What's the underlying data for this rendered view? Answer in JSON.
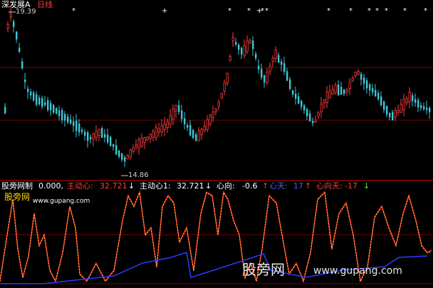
{
  "top_panel": {
    "stock_name": "深发展A",
    "period_label": "日线",
    "high_price_label": "19.39",
    "low_price_label": "14.86",
    "colors": {
      "up": "#ff3b3b",
      "down": "#3cc8d8",
      "name": "#ffffff",
      "period": "#ff3b3b",
      "grid": "#7a0000"
    }
  },
  "signal_stars": {
    "glyphs": [
      "*",
      "+",
      "*",
      "*",
      "+",
      "*",
      "*",
      "*",
      "*",
      "*",
      "*",
      "*",
      "*",
      "*"
    ]
  },
  "indicator_panel": {
    "title": "股旁网制",
    "base_value": "0.000,",
    "fields": [
      {
        "label": "主动心:",
        "value": "32.721",
        "arrow": "↓",
        "color": "#ff3b3b",
        "arrow_color": "#ffffff"
      },
      {
        "label": "主动心1:",
        "value": "32.721",
        "arrow": "↓",
        "color": "#ffffff",
        "arrow_color": "#ffffff"
      },
      {
        "label": "心向:",
        "value": "-0.6",
        "arrow": "↑",
        "color": "#ffffff",
        "arrow_color": "#ff3b3b"
      },
      {
        "label": "心天:",
        "value": "17",
        "arrow": "↑",
        "color": "#4a5cff",
        "arrow_color": "#ff3b3b"
      },
      {
        "label": "心向天:",
        "value": "-17",
        "arrow": "↓",
        "color": "#ff3b3b",
        "arrow_color": "#3cff3c"
      }
    ],
    "brand_label": "股旁网",
    "site_url": "www.gupang.com",
    "watermark": {
      "name": "股旁网",
      "url": "www.gupang.com"
    }
  }
}
